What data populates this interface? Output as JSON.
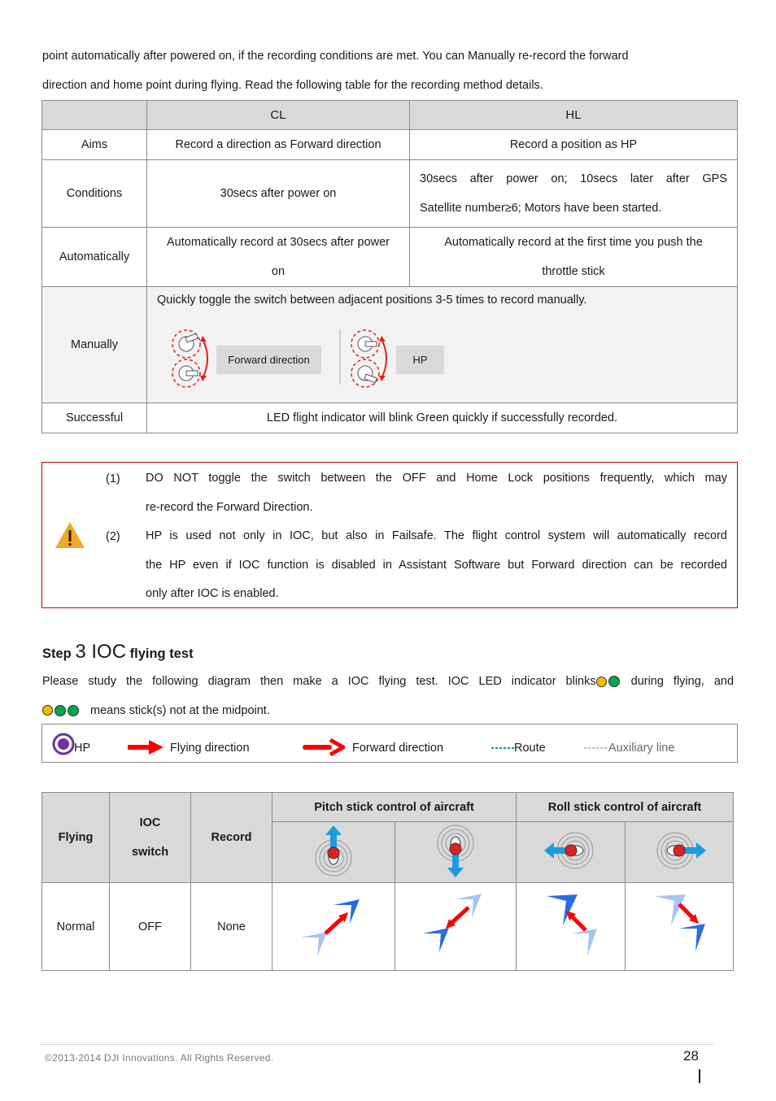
{
  "intro": {
    "line1": "point automatically after powered on, if the recording conditions are met. You can Manually re-record the forward",
    "line2": "direction and home point during flying. Read the following table for the recording method details."
  },
  "record_table": {
    "headers": [
      "",
      "CL",
      "HL"
    ],
    "rows": [
      {
        "label": "Aims",
        "cl": "Record a direction as Forward direction",
        "hl": "Record a position as HP"
      },
      {
        "label": "Conditions",
        "cl": "30secs after power on",
        "hl_line1": "30secs after power on; 10secs later after GPS",
        "hl_line2": "Satellite number≥6; Motors have been started."
      },
      {
        "label": "Automatically",
        "cl_line1": "Automatically record at 30secs after power",
        "cl_line2": "on",
        "hl_line1": "Automatically record at the first time you push the",
        "hl_line2": "throttle stick"
      },
      {
        "label": "Manually",
        "text": "Quickly toggle the switch between adjacent positions 3-5 times to record manually.",
        "box1": "Forward direction",
        "box2": "HP"
      },
      {
        "label": "Successful",
        "text": "LED flight indicator will blink Green quickly if successfully recorded."
      }
    ]
  },
  "warning": {
    "icon": "warning-triangle-icon",
    "items": [
      {
        "num": "(1)",
        "line1": "DO NOT toggle the switch between the OFF and Home Lock positions frequently, which may",
        "line2": "re-record the Forward Direction."
      },
      {
        "num": "(2)",
        "line1": "HP is used not only in IOC, but also in Failsafe. The flight control system will automatically record",
        "line2": "the HP even if IOC function is disabled in Assistant Software but Forward direction can be recorded",
        "line3": "only after IOC is enabled."
      }
    ]
  },
  "step": {
    "prefix": "Step",
    "number": "3 IOC",
    "suffix": "flying test"
  },
  "step_text": {
    "line1a": "Please study the following diagram then make a IOC flying test. IOC LED indicator blinks",
    "line1b": "during flying, and",
    "line2": "means stick(s) not at the midpoint."
  },
  "colors": {
    "led_yellow": "#f5b800",
    "led_green": "#00a651",
    "warning_border": "#c00000",
    "warning_fill": "#f5a623",
    "hp_purple": "#7030a0",
    "arrow_red": "#ff0000",
    "route_green": "#00a651",
    "stick_blue": "#1e9be0",
    "plane_blue": "#2a6fe0",
    "plane_light": "#a9c4f2"
  },
  "legend": {
    "hp": "HP",
    "flying_direction": "Flying direction",
    "forward_direction": "Forward direction",
    "route": "Route",
    "auxiliary": "Auxiliary line"
  },
  "ioc_table": {
    "headers": {
      "flying": "Flying",
      "ioc_line1": "IOC",
      "ioc_line2": "switch",
      "record": "Record",
      "pitch": "Pitch stick control of aircraft",
      "roll": "Roll stick control of aircraft"
    },
    "stick_icons": [
      "stick-up-icon",
      "stick-down-icon",
      "stick-left-icon",
      "stick-right-icon"
    ],
    "rows": [
      {
        "flying": "Normal",
        "ioc": "OFF",
        "record": "None",
        "diagrams": [
          "plane-forward-icon",
          "plane-backward-icon",
          "plane-left-icon",
          "plane-right-icon"
        ]
      }
    ]
  },
  "footer": {
    "copyright": "©2013-2014  DJI  Innovations.  All  Rights  Reserved.",
    "page": "28"
  }
}
